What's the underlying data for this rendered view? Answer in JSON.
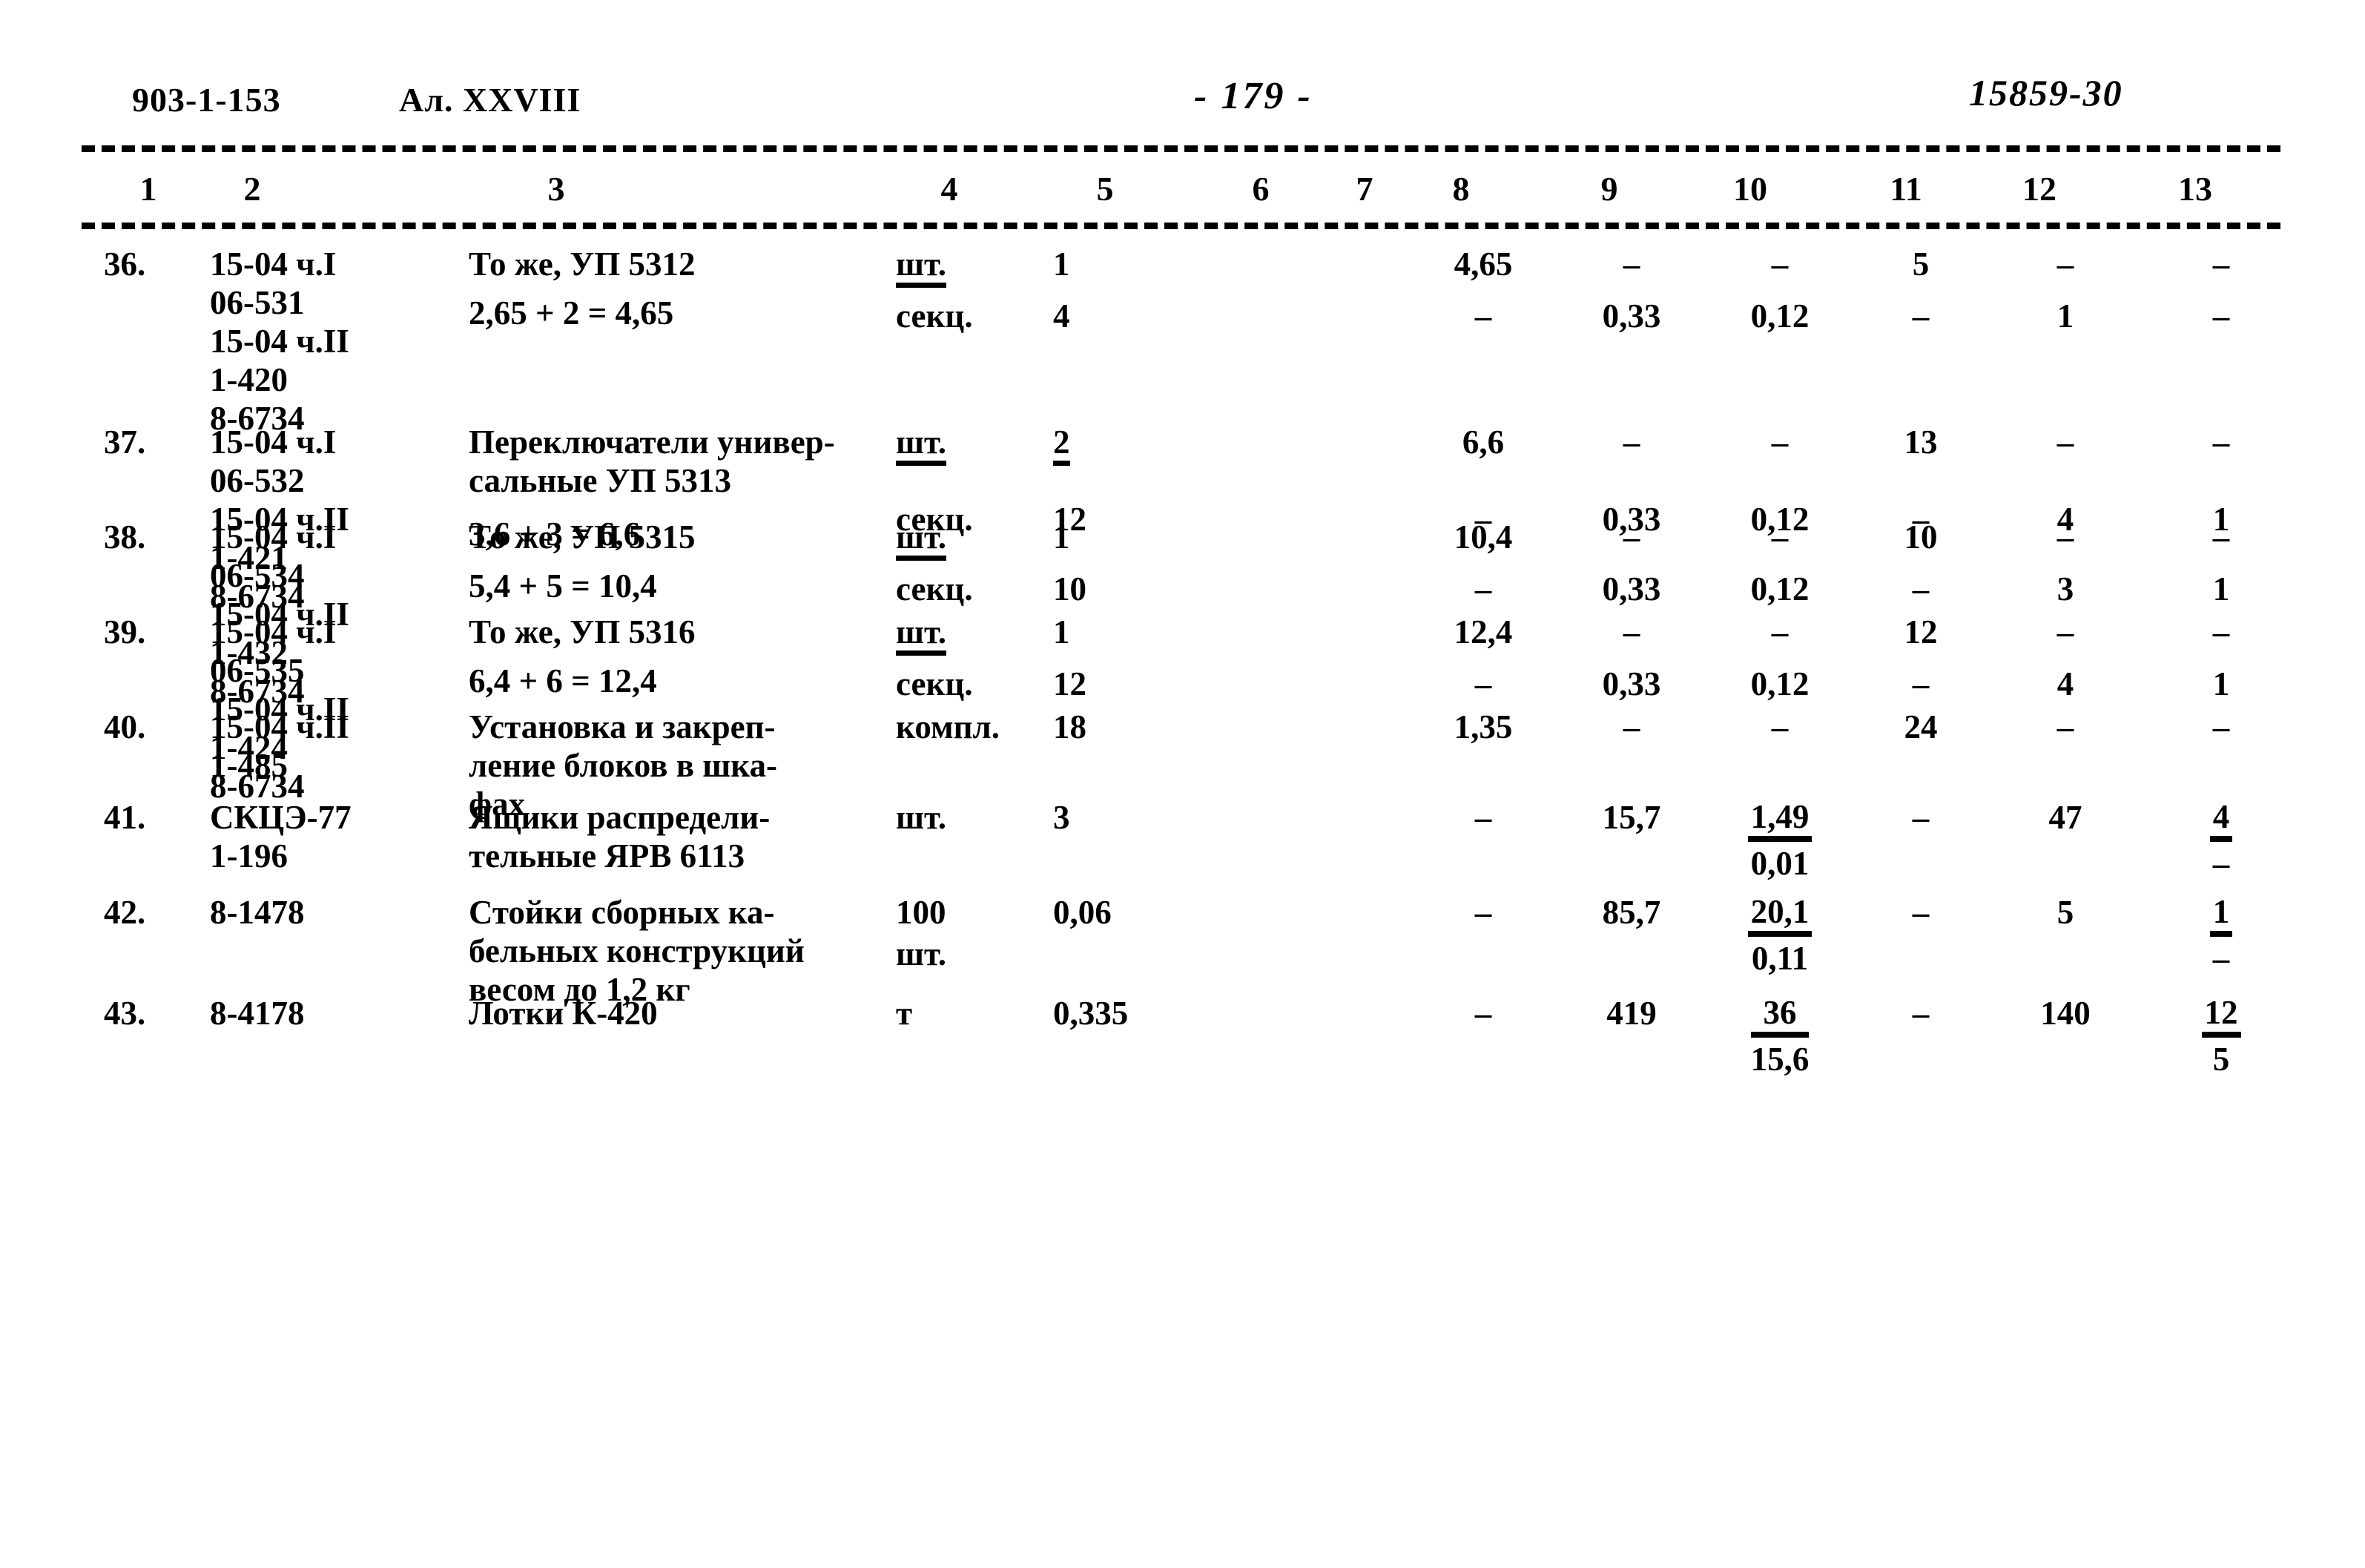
{
  "header": {
    "doc_code": "903-1-153",
    "album": "Ал. XXVIII",
    "page_number": "- 179 -",
    "sheet_code": "15859-30"
  },
  "column_numbers": [
    "1",
    "2",
    "3",
    "4",
    "5",
    "6",
    "7",
    "8",
    "9",
    "10",
    "11",
    "12",
    "13"
  ],
  "rows": [
    {
      "no": "36.",
      "codes": [
        "15-04 ч.I",
        "06-531",
        "15-04 ч.II",
        "1-420",
        "8-6734"
      ],
      "desc": [
        "То же, УП 5312",
        "2,65 + 2 = 4,65"
      ],
      "units": [
        "шт.",
        "секц."
      ],
      "unit_underline": [
        true,
        false
      ],
      "qty": [
        "1",
        "4"
      ],
      "c6": [
        "",
        ""
      ],
      "c7": [
        "",
        ""
      ],
      "c8": [
        "4,65",
        "–"
      ],
      "c9": [
        "–",
        "0,33"
      ],
      "c10": [
        "–",
        "0,12"
      ],
      "c11": [
        "5",
        "–"
      ],
      "c12": [
        "–",
        "1"
      ],
      "c13": [
        "–",
        "–"
      ]
    },
    {
      "no": "37.",
      "codes": [
        "15-04 ч.I",
        "06-532",
        "15-04 ч.II",
        "1-421",
        "8-6734"
      ],
      "desc": [
        "Переключатели универ-",
        "сальные УП 5313",
        "3,6 + 3 = 6,6"
      ],
      "units": [
        "шт.",
        "секц."
      ],
      "unit_underline": [
        true,
        false
      ],
      "qty": [
        "2",
        "12"
      ],
      "qty_underline": [
        true,
        false
      ],
      "c8": [
        "6,6",
        "–"
      ],
      "c9": [
        "–",
        "0,33"
      ],
      "c10": [
        "–",
        "0,12"
      ],
      "c11": [
        "13",
        "–"
      ],
      "c12": [
        "–",
        "4"
      ],
      "c13": [
        "–",
        "1"
      ]
    },
    {
      "no": "38.",
      "codes": [
        "15-04 ч.I",
        "06-534",
        "15-04 ч.II",
        "1-432",
        "8-6734"
      ],
      "desc": [
        "То же, УП 5315",
        "5,4 + 5 = 10,4"
      ],
      "units": [
        "шт.",
        "секц."
      ],
      "unit_underline": [
        true,
        false
      ],
      "qty": [
        "1",
        "10"
      ],
      "c8": [
        "10,4",
        "–"
      ],
      "c9": [
        "–",
        "0,33"
      ],
      "c10": [
        "–",
        "0,12"
      ],
      "c11": [
        "10",
        "–"
      ],
      "c12": [
        "–",
        "3"
      ],
      "c13": [
        "–",
        "1"
      ]
    },
    {
      "no": "39.",
      "codes": [
        "15-04 ч.I",
        "06-535",
        "15-04 ч.II",
        "1-424",
        "8-6734"
      ],
      "desc": [
        "То же, УП 5316",
        "6,4 + 6 = 12,4"
      ],
      "units": [
        "шт.",
        "секц."
      ],
      "unit_underline": [
        true,
        false
      ],
      "qty": [
        "1",
        "12"
      ],
      "c8": [
        "12,4",
        "–"
      ],
      "c9": [
        "–",
        "0,33"
      ],
      "c10": [
        "–",
        "0,12"
      ],
      "c11": [
        "12",
        "–"
      ],
      "c12": [
        "–",
        "4"
      ],
      "c13": [
        "–",
        "1"
      ]
    },
    {
      "no": "40.",
      "codes": [
        "15-04 ч.II",
        "1-485"
      ],
      "desc": [
        "Установка и закреп-",
        "ление блоков в шка-",
        "фах"
      ],
      "units": [
        "компл."
      ],
      "unit_underline": [
        false
      ],
      "qty": [
        "18"
      ],
      "c8": [
        "1,35"
      ],
      "c9": [
        "–"
      ],
      "c10": [
        "–"
      ],
      "c11": [
        "24"
      ],
      "c12": [
        "–"
      ],
      "c13": [
        "–"
      ]
    },
    {
      "no": "41.",
      "codes": [
        "СКЦЭ-77",
        "1-196"
      ],
      "desc": [
        "Ящики распредели-",
        "тельные ЯРВ 6113"
      ],
      "units": [
        "шт."
      ],
      "unit_underline": [
        false
      ],
      "qty": [
        "3"
      ],
      "c8": [
        "–"
      ],
      "c9": [
        "15,7"
      ],
      "c10_frac": {
        "n": "1,49",
        "d": "0,01"
      },
      "c11": [
        "–"
      ],
      "c12": [
        "47"
      ],
      "c13_frac": {
        "n": "4",
        "d": "–"
      }
    },
    {
      "no": "42.",
      "codes": [
        "8-1478"
      ],
      "desc": [
        "Стойки сборных ка-",
        "бельных конструкций",
        "весом до 1,2 кг"
      ],
      "units": [
        "100",
        "шт."
      ],
      "unit_underline": [
        false,
        false
      ],
      "qty": [
        "0,06"
      ],
      "c8": [
        "–"
      ],
      "c9": [
        "85,7"
      ],
      "c10_frac": {
        "n": "20,1",
        "d": "0,11"
      },
      "c11": [
        "–"
      ],
      "c12": [
        "5"
      ],
      "c13_frac": {
        "n": "1",
        "d": "–"
      }
    },
    {
      "no": "43.",
      "codes": [
        "8-4178"
      ],
      "desc": [
        "Лотки К-420"
      ],
      "units": [
        "т"
      ],
      "unit_underline": [
        false
      ],
      "qty": [
        "0,335"
      ],
      "c8": [
        "–"
      ],
      "c9": [
        "419"
      ],
      "c10_frac": {
        "n": "36",
        "d": "15,6"
      },
      "c11": [
        "–"
      ],
      "c12": [
        "140"
      ],
      "c13_frac": {
        "n": "12",
        "d": "5"
      }
    }
  ]
}
